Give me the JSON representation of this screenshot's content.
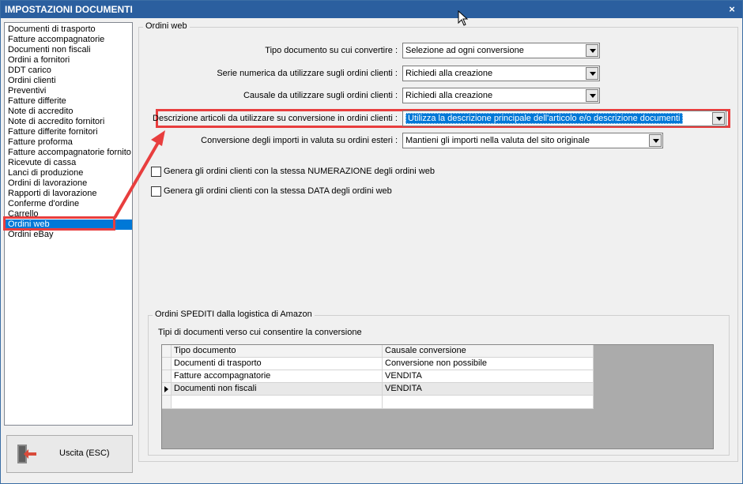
{
  "window": {
    "title": "IMPOSTAZIONI DOCUMENTI",
    "close_glyph": "×"
  },
  "sidebar": {
    "items": [
      {
        "label": "Documenti di trasporto"
      },
      {
        "label": "Fatture accompagnatorie"
      },
      {
        "label": "Documenti non fiscali"
      },
      {
        "label": "Ordini a fornitori"
      },
      {
        "label": "DDT carico"
      },
      {
        "label": "Ordini clienti"
      },
      {
        "label": "Preventivi"
      },
      {
        "label": "Fatture differite"
      },
      {
        "label": "Note di accredito"
      },
      {
        "label": "Note di accredito fornitori"
      },
      {
        "label": "Fatture differite fornitori"
      },
      {
        "label": "Fatture proforma"
      },
      {
        "label": "Fatture accompagnatorie fornito"
      },
      {
        "label": "Ricevute di cassa"
      },
      {
        "label": "Lanci di produzione"
      },
      {
        "label": "Ordini di lavorazione"
      },
      {
        "label": "Rapporti di lavorazione"
      },
      {
        "label": "Conferme d'ordine"
      },
      {
        "label": "Carrello"
      },
      {
        "label": "Ordini web"
      },
      {
        "label": "Ordini eBay"
      }
    ],
    "selected_index": 19
  },
  "exit_button": {
    "label": "Uscita (ESC)",
    "icon": "exit-door-icon"
  },
  "main": {
    "group_title": "Ordini web",
    "fields": [
      {
        "label": "Tipo documento su cui convertire :",
        "value": "Selezione ad ogni conversione"
      },
      {
        "label": "Serie numerica da utilizzare sugli ordini clienti :",
        "value": "Richiedi alla creazione"
      },
      {
        "label": "Causale da utilizzare sugli ordini clienti :",
        "value": "Richiedi alla creazione"
      },
      {
        "label": "Descrizione articoli da utilizzare su conversione in ordini clienti :",
        "value": "Utilizza la descrizione principale dell'articolo e/o descrizione documenti"
      },
      {
        "label": "Conversione degli importi in valuta su ordini esteri :",
        "value": "Mantieni gli importi nella valuta del sito originale"
      }
    ],
    "checkboxes": [
      {
        "label": "Genera gli ordini clienti con la stessa NUMERAZIONE degli ordini web",
        "checked": false
      },
      {
        "label": "Genera gli ordini clienti con la stessa DATA degli ordini web",
        "checked": false
      }
    ]
  },
  "amazon": {
    "group_title": "Ordini SPEDITI dalla logistica di Amazon",
    "subtitle": "Tipi di documenti verso cui consentire la conversione",
    "columns": [
      "Tipo documento",
      "Causale conversione"
    ],
    "rows": [
      {
        "tipo": "Documenti di trasporto",
        "causale": "Conversione non possibile"
      },
      {
        "tipo": "Fatture accompagnatorie",
        "causale": "VENDITA"
      },
      {
        "tipo": "Documenti non fiscali",
        "causale": "VENDITA"
      },
      {
        "tipo": "",
        "causale": ""
      }
    ],
    "current_row_index": 2
  },
  "colors": {
    "titlebar": "#2b5f9f",
    "selection": "#0078d7",
    "highlight_annotation": "#e83e3e"
  }
}
